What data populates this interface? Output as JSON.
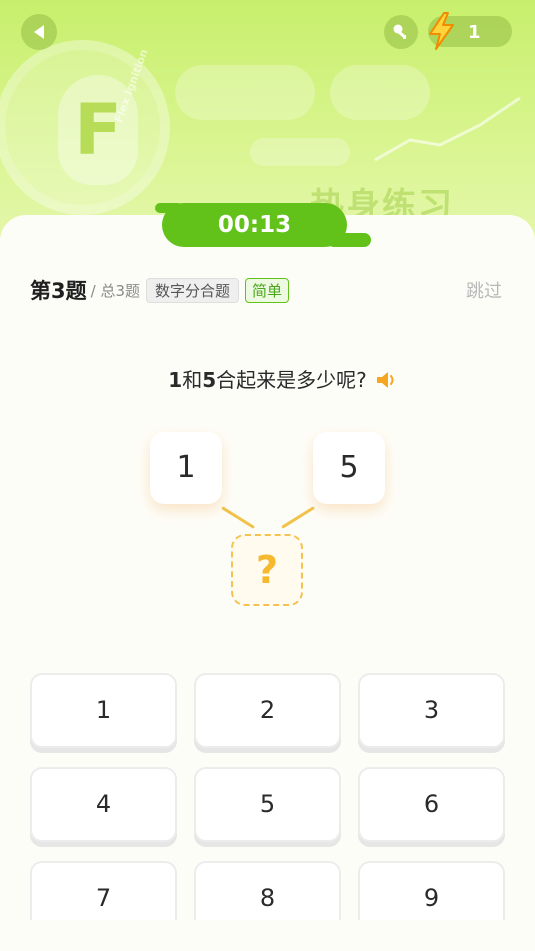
{
  "header": {
    "energy_count": "1",
    "banner_logo_letter": "F",
    "banner_ring_text": "Flex ignition",
    "banner_heading": "热身练习"
  },
  "timer": "00:13",
  "question_meta": {
    "number": "第3题",
    "total": "/ 总3题",
    "category": "数字分合题",
    "level": "简单",
    "skip_label": "跳过"
  },
  "question": {
    "prefix_a": "1",
    "mid": "和",
    "prefix_b": "5",
    "rest": "合起来是多少呢?"
  },
  "tree": {
    "left": "1",
    "right": "5",
    "answer_placeholder": "?"
  },
  "keypad": [
    "1",
    "2",
    "3",
    "4",
    "5",
    "6",
    "7",
    "8",
    "9"
  ],
  "colors": {
    "accent_green": "#63c21a",
    "answer_orange": "#f5b82e"
  }
}
